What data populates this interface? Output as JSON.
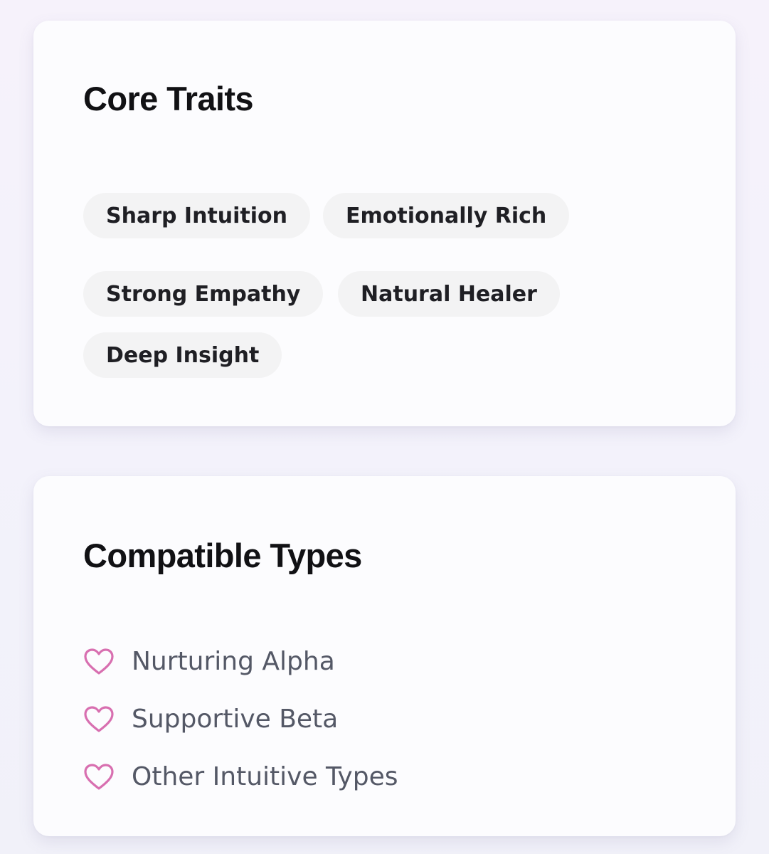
{
  "core_traits": {
    "title": "Core Traits",
    "tags": [
      "Sharp Intuition",
      "Emotionally Rich",
      "Strong Empathy",
      "Natural Healer",
      "Deep Insight"
    ]
  },
  "compatible_types": {
    "title": "Compatible Types",
    "icon": "heart-outline-icon",
    "icon_color": "#d86fb0",
    "items": [
      "Nurturing Alpha",
      "Supportive Beta",
      "Other Intuitive Types"
    ]
  }
}
